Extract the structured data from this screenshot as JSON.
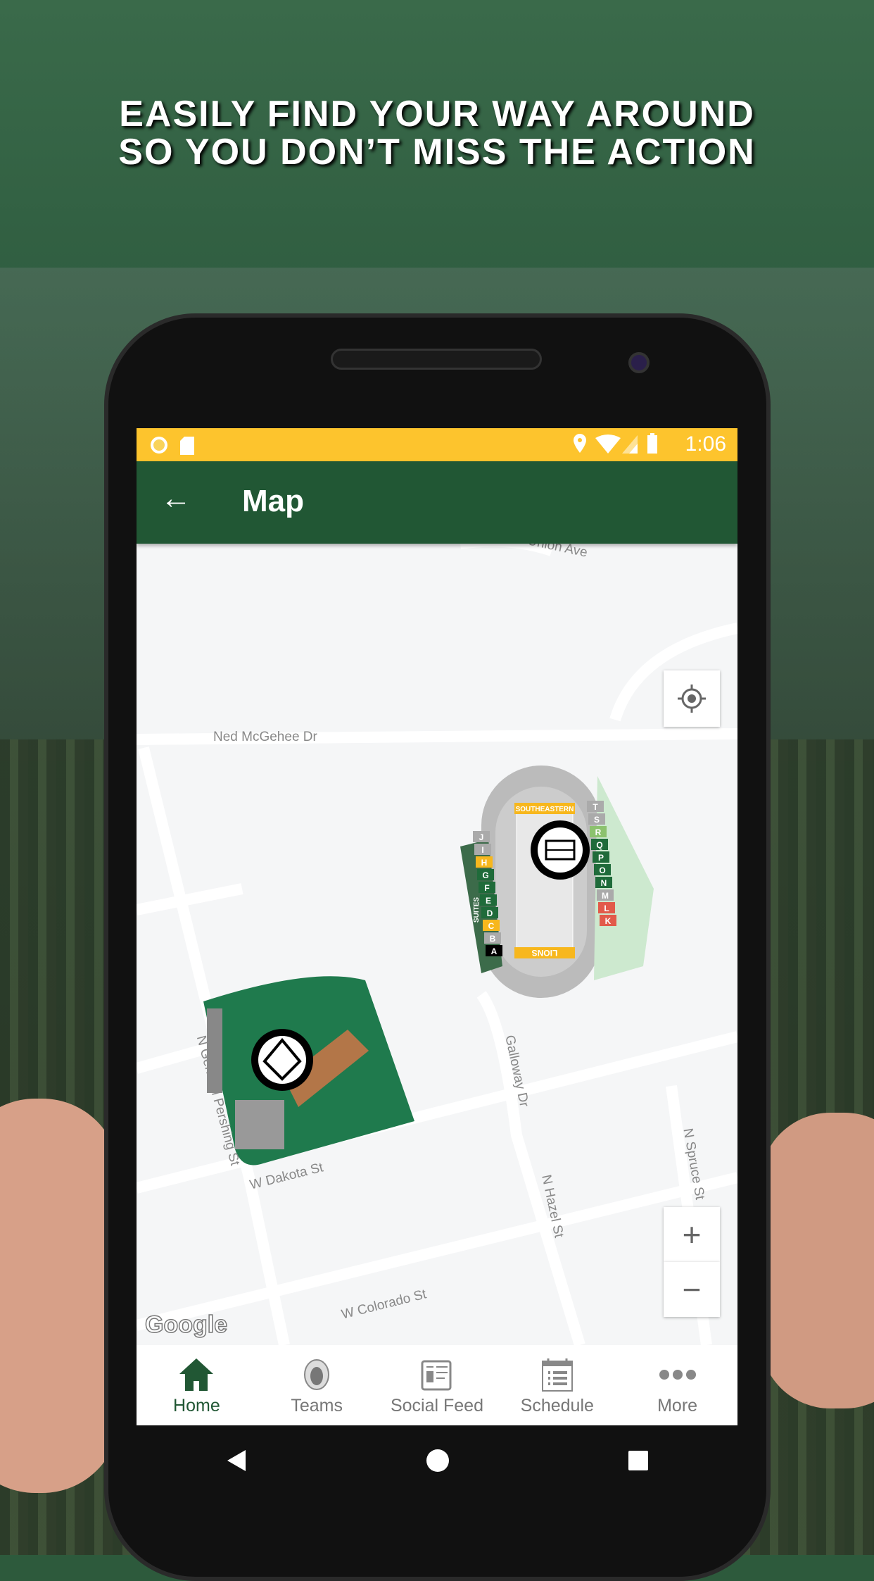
{
  "headline": {
    "line1": "EASILY FIND YOUR WAY AROUND",
    "line2": "SO YOU DON’T MISS THE ACTION"
  },
  "status_bar": {
    "time": "1:06",
    "icons": [
      "circle-notification-icon",
      "sd-card-icon",
      "location-icon",
      "wifi-icon",
      "signal-icon",
      "battery-icon"
    ],
    "color": "#fdc42d"
  },
  "toolbar": {
    "title": "Map",
    "back_icon": "arrow-left-icon",
    "color": "#215734"
  },
  "map": {
    "streets": [
      "Union Ave",
      "Ned McGehee Dr",
      "N General Pershing St",
      "W Dakota St",
      "Galloway Dr",
      "N Hazel St",
      "N Spruce St",
      "W Colorado St"
    ],
    "stadium_labels": [
      "SOUTHEASTERN",
      "LIONS",
      "SUITES"
    ],
    "stadium_sections_left": [
      "J",
      "I",
      "H",
      "G",
      "F",
      "E",
      "D",
      "C",
      "B",
      "A"
    ],
    "stadium_sections_right": [
      "T",
      "S",
      "R",
      "Q",
      "P",
      "O",
      "N",
      "M",
      "L",
      "K"
    ],
    "attribution": "Google",
    "zoom_in": "+",
    "zoom_out": "−"
  },
  "bottom_nav": [
    {
      "label": "Home",
      "icon": "home-icon",
      "active": true
    },
    {
      "label": "Teams",
      "icon": "lion-icon",
      "active": false
    },
    {
      "label": "Social Feed",
      "icon": "newspaper-icon",
      "active": false
    },
    {
      "label": "Schedule",
      "icon": "calendar-list-icon",
      "active": false
    },
    {
      "label": "More",
      "icon": "more-dots-icon",
      "active": false
    }
  ]
}
